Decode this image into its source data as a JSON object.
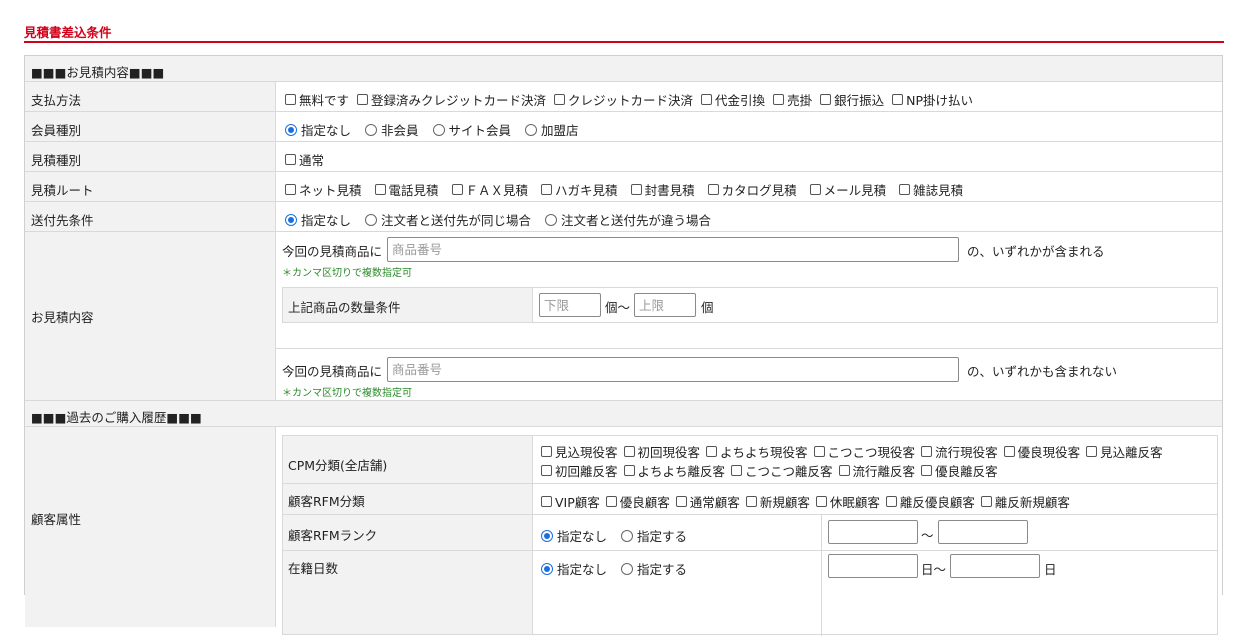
{
  "page_title": "見積書差込条件",
  "section1": {
    "header": "■■■お見積内容■■■",
    "payment": {
      "label": "支払方法",
      "options": [
        "無料です",
        "登録済みクレジットカード決済",
        "クレジットカード決済",
        "代金引換",
        "売掛",
        "銀行振込",
        "NP掛け払い"
      ]
    },
    "member_type": {
      "label": "会員種別",
      "options": [
        "指定なし",
        "非会員",
        "サイト会員",
        "加盟店"
      ]
    },
    "estimate_type": {
      "label": "見積種別",
      "options": [
        "通常"
      ]
    },
    "estimate_route": {
      "label": "見積ルート",
      "options": [
        "ネット見積",
        "電話見積",
        "ＦＡＸ見積",
        "ハガキ見積",
        "封書見積",
        "カタログ見積",
        "メール見積",
        "雑誌見積"
      ]
    },
    "shipping": {
      "label": "送付先条件",
      "options": [
        "指定なし",
        "注文者と送付先が同じ場合",
        "注文者と送付先が違う場合"
      ]
    },
    "content": {
      "label": "お見積内容",
      "include_prefix": "今回の見積商品に",
      "include_placeholder": "商品番号",
      "include_suffix": "の、いずれかが含まれる",
      "note": "＊カンマ区切りで複数指定可",
      "qty_label": "上記商品の数量条件",
      "qty_min_placeholder": "下限",
      "qty_mid": "個〜",
      "qty_max_placeholder": "上限",
      "qty_unit": "個",
      "exclude_prefix": "今回の見積商品に",
      "exclude_placeholder": "商品番号",
      "exclude_suffix": "の、いずれかも含まれない",
      "note2": "＊カンマ区切りで複数指定可"
    }
  },
  "section2": {
    "header": "■■■過去のご購入履歴■■■",
    "customer_attr": {
      "label": "顧客属性",
      "cpm": {
        "label": "CPM分類(全店舗)",
        "line1": [
          "見込現役客",
          "初回現役客",
          "よちよち現役客",
          "こつこつ現役客",
          "流行現役客",
          "優良現役客",
          "見込離反客"
        ],
        "line2": [
          "初回離反客",
          "よちよち離反客",
          "こつこつ離反客",
          "流行離反客",
          "優良離反客"
        ]
      },
      "rfm_class": {
        "label": "顧客RFM分類",
        "options": [
          "VIP顧客",
          "優良顧客",
          "通常顧客",
          "新規顧客",
          "休眠顧客",
          "離反優良顧客",
          "離反新規顧客"
        ]
      },
      "rfm_rank": {
        "label": "顧客RFMランク",
        "options": [
          "指定なし",
          "指定する"
        ],
        "range_sep": "〜"
      },
      "tenure": {
        "label": "在籍日数",
        "options": [
          "指定なし",
          "指定する"
        ],
        "unit1": "日〜",
        "unit2": "日"
      }
    }
  }
}
